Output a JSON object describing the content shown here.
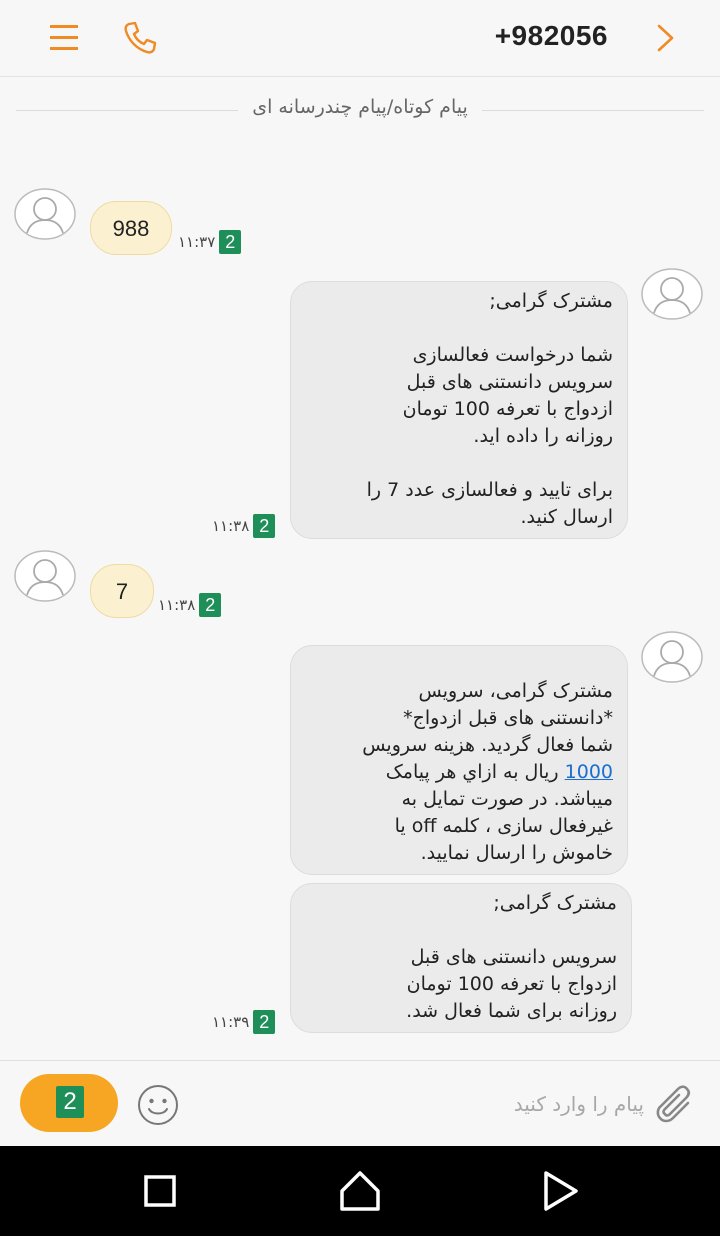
{
  "header": {
    "title": "+982056",
    "accent_color": "#f08a24",
    "icons": [
      "hamburger-menu-icon",
      "phone-icon",
      "chevron-right-icon"
    ]
  },
  "thread": {
    "type_label": "پیام کوتاه/پیام چندرسانه ای"
  },
  "messages": [
    {
      "direction": "outgoing",
      "text": "988",
      "time": "۱۱:۳۷",
      "sim": "2"
    },
    {
      "direction": "incoming",
      "text": "مشترک گرامی;\n\nشما درخواست فعالسازی\nسرویس دانستنی های قبل\nازدواج با تعرفه 100 تومان\nروزانه را داده اید.\n\nبرای تایید و فعالسازی عدد 7 را\nارسال کنید.",
      "time": "۱۱:۳۸",
      "sim": "2"
    },
    {
      "direction": "outgoing",
      "text": "7",
      "time": "۱۱:۳۸",
      "sim": "2"
    },
    {
      "direction": "incoming",
      "text_before_link": "مشترک گرامی، سرویس\n*دانستنی های قبل ازدواج*\nشما فعال گردید. هزینه سرویس\n",
      "link": "1000",
      "text_after_link": " ریال به ازاي هر پیامک\nمیباشد. در صورت تمایل به\nغیرفعال سازی ، کلمه off یا\nخاموش را ارسال نمایید."
    },
    {
      "direction": "incoming",
      "text": "مشترک گرامی;\n\nسرویس دانستنی های قبل\nازدواج با تعرفه 100 تومان\nروزانه برای شما فعال شد.",
      "time": "۱۱:۳۹",
      "sim": "2"
    }
  ],
  "composer": {
    "placeholder": "پیام را وارد کنید",
    "send_sim": "2",
    "send_color": "#f6a623"
  },
  "colors": {
    "outgoing_bubble": "#fbf0cf",
    "incoming_bubble": "#ebebeb",
    "sim_badge": "#1f8f5a",
    "link": "#1a6fcf"
  }
}
